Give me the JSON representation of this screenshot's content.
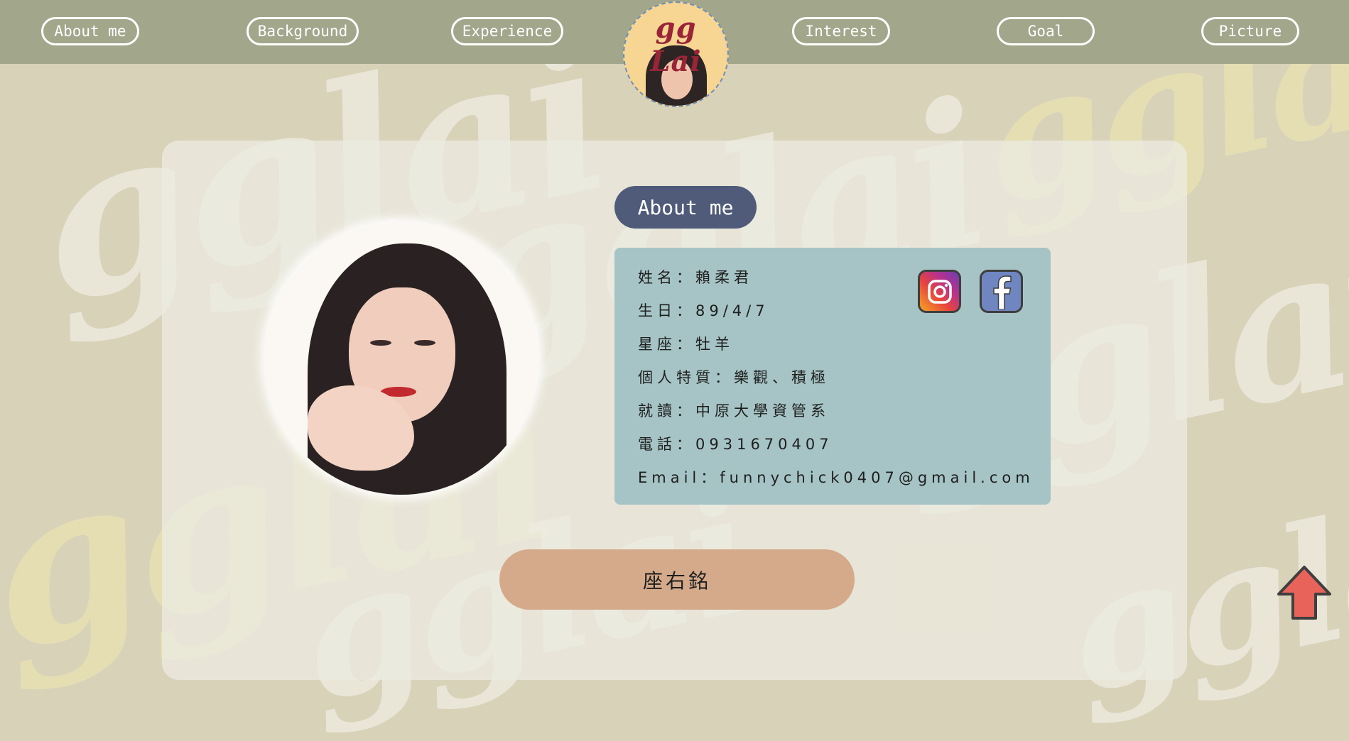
{
  "nav": {
    "items": [
      {
        "label": "About me"
      },
      {
        "label": "Background"
      },
      {
        "label": "Experience"
      },
      {
        "label": "Interest"
      },
      {
        "label": "Goal"
      },
      {
        "label": "Picture"
      }
    ],
    "logo_text": "gg Lai"
  },
  "background_watermark": "gglai",
  "section": {
    "title": "About me"
  },
  "info": {
    "rows": [
      "姓名：賴柔君",
      "生日：89/4/7",
      "星座：牡羊",
      "個人特質：樂觀、積極",
      "就讀：中原大學資管系",
      "電話：0931670407",
      "Email：funnychick0407@gmail.com"
    ]
  },
  "social": {
    "icons": [
      "instagram-icon",
      "facebook-icon"
    ]
  },
  "motto": {
    "label": "座右銘"
  },
  "colors": {
    "nav_bg": "#a2a78c",
    "page_bg": "#d8d2b9",
    "title_pill": "#4f5b79",
    "info_bg": "#a6c4c5",
    "motto_bg": "#d4aa8b",
    "scroll_top": "#e8645a"
  }
}
